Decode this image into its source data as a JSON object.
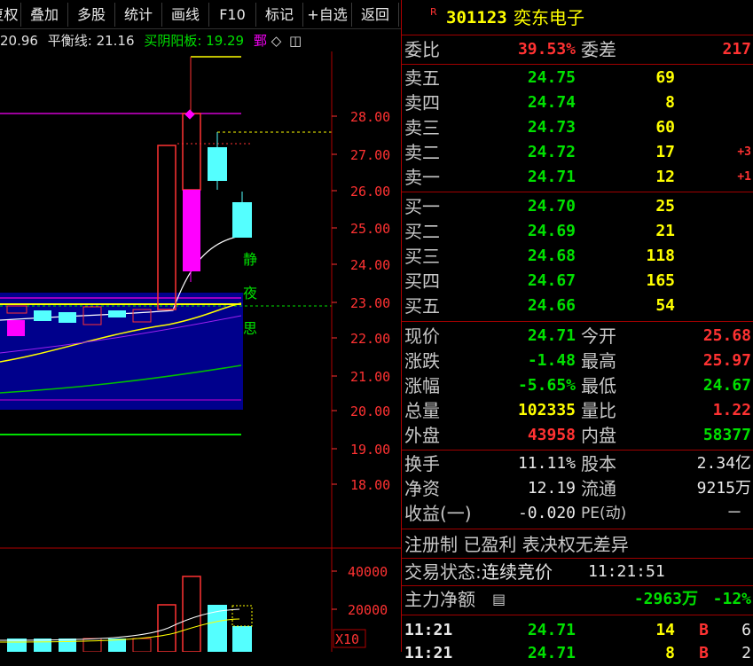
{
  "toolbar": {
    "buttons": [
      "复权",
      "叠加",
      "多股",
      "统计",
      "画线",
      "F10",
      "标记",
      "+自选",
      "返回"
    ]
  },
  "info_line": {
    "value1": "20.96",
    "balance_label": "平衡线:",
    "balance_value": "21.16",
    "buysell_label": "买阴阳板:",
    "buysell_value": "19.29",
    "tag": "鄄"
  },
  "chart": {
    "y_ticks": [
      "28.00",
      "27.00",
      "26.00",
      "25.00",
      "24.00",
      "23.00",
      "22.00",
      "21.00",
      "20.00",
      "19.00",
      "18.00"
    ],
    "vol_ticks": [
      "40000",
      "20000"
    ],
    "vol_unit": "X10",
    "annotation": [
      "静",
      "夜",
      "思"
    ],
    "colors": {
      "up": "#ff3232",
      "down": "#54ffff",
      "magenta": "#ff00ff",
      "ma_white": "#ffffff",
      "ma_yellow": "#ffff00",
      "ma_green": "#00c000",
      "band": "#0000a0"
    }
  },
  "quote": {
    "r_badge": "R",
    "code": "301123",
    "name": "奕东电子",
    "weibi_label": "委比",
    "weibi_value": "39.53%",
    "weicha_label": "委差",
    "weicha_value": "217",
    "asks": [
      {
        "label": "卖五",
        "price": "24.75",
        "vol": "69",
        "chg": ""
      },
      {
        "label": "卖四",
        "price": "24.74",
        "vol": "8",
        "chg": ""
      },
      {
        "label": "卖三",
        "price": "24.73",
        "vol": "60",
        "chg": ""
      },
      {
        "label": "卖二",
        "price": "24.72",
        "vol": "17",
        "chg": "+3"
      },
      {
        "label": "卖一",
        "price": "24.71",
        "vol": "12",
        "chg": "+1"
      }
    ],
    "bids": [
      {
        "label": "买一",
        "price": "24.70",
        "vol": "25"
      },
      {
        "label": "买二",
        "price": "24.69",
        "vol": "21"
      },
      {
        "label": "买三",
        "price": "24.68",
        "vol": "118"
      },
      {
        "label": "买四",
        "price": "24.67",
        "vol": "165"
      },
      {
        "label": "买五",
        "price": "24.66",
        "vol": "54"
      }
    ],
    "stats1": [
      {
        "l1": "现价",
        "v1": "24.71",
        "c1": "green",
        "l2": "今开",
        "v2": "25.68",
        "c2": "red"
      },
      {
        "l1": "涨跌",
        "v1": "-1.48",
        "c1": "green",
        "l2": "最高",
        "v2": "25.97",
        "c2": "red"
      },
      {
        "l1": "涨幅",
        "v1": "-5.65%",
        "c1": "green",
        "l2": "最低",
        "v2": "24.67",
        "c2": "green"
      },
      {
        "l1": "总量",
        "v1": "102335",
        "c1": "yellow",
        "l2": "量比",
        "v2": "1.22",
        "c2": "red"
      },
      {
        "l1": "外盘",
        "v1": "43958",
        "c1": "red",
        "l2": "内盘",
        "v2": "58377",
        "c2": "green"
      }
    ],
    "stats2": [
      {
        "l1": "换手",
        "v1": "11.11%",
        "l2": "股本",
        "v2": "2.34亿"
      },
      {
        "l1": "净资",
        "v1": "12.19",
        "l2": "流通",
        "v2": "9215万"
      },
      {
        "l1": "收益(一)",
        "v1": "-0.020",
        "l2": "PE(动)",
        "v2": "－"
      }
    ],
    "reg_info": "注册制 已盈利 表决权无差异",
    "trade_status_label": "交易状态:",
    "trade_status_value": "连续竞价",
    "trade_time": "11:21:51",
    "main_net_label": "主力净额",
    "main_net_value": "-2963万",
    "main_net_pct": "-12%",
    "ticks": [
      {
        "time": "11:21",
        "price": "24.71",
        "vol": "14",
        "bs": "B",
        "n": "6"
      },
      {
        "time": "11:21",
        "price": "24.71",
        "vol": "8",
        "bs": "B",
        "n": "2"
      }
    ]
  }
}
